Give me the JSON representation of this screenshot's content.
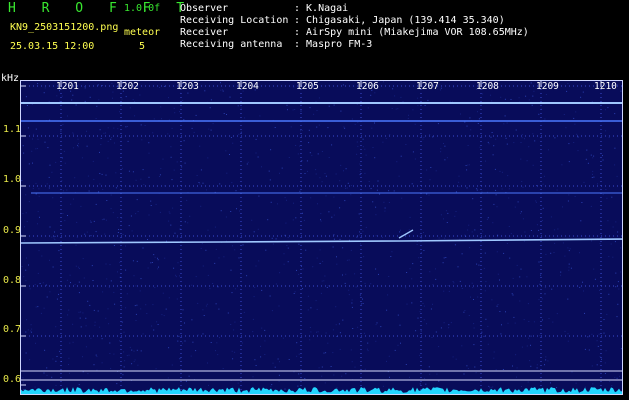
{
  "header": {
    "title": "H R O F F T",
    "version": "1.0.0f",
    "filename": "KN9_2503151200.png",
    "datetime": "25.03.15 12:00",
    "meteor_label": "meteor",
    "meteor_count": "5"
  },
  "info": [
    {
      "label": "Observer",
      "value": ": K.Nagai"
    },
    {
      "label": "Receiving Location",
      "value": ": Chigasaki, Japan (139.414 35.340)"
    },
    {
      "label": "Receiver",
      "value": ": AirSpy mini (Miakejima VOR 108.65MHz)"
    },
    {
      "label": "Receiving antenna",
      "value": ": Maspro FM-3"
    }
  ],
  "y_axis": {
    "unit": "kHz",
    "ticks": [
      "1.1",
      "1.0",
      "0.9",
      "0.8",
      "0.7",
      "0.6"
    ]
  },
  "x_axis": {
    "ticks": [
      "1201",
      "1202",
      "1203",
      "1204",
      "1205",
      "1206",
      "1207",
      "1208",
      "1209",
      "1210"
    ]
  },
  "colors": {
    "background": "#080c5a",
    "signal": "#4b78ff",
    "bright_signal": "#9fc8ff",
    "baseline": "#21d6ff",
    "grid": "#d8dcff"
  }
}
